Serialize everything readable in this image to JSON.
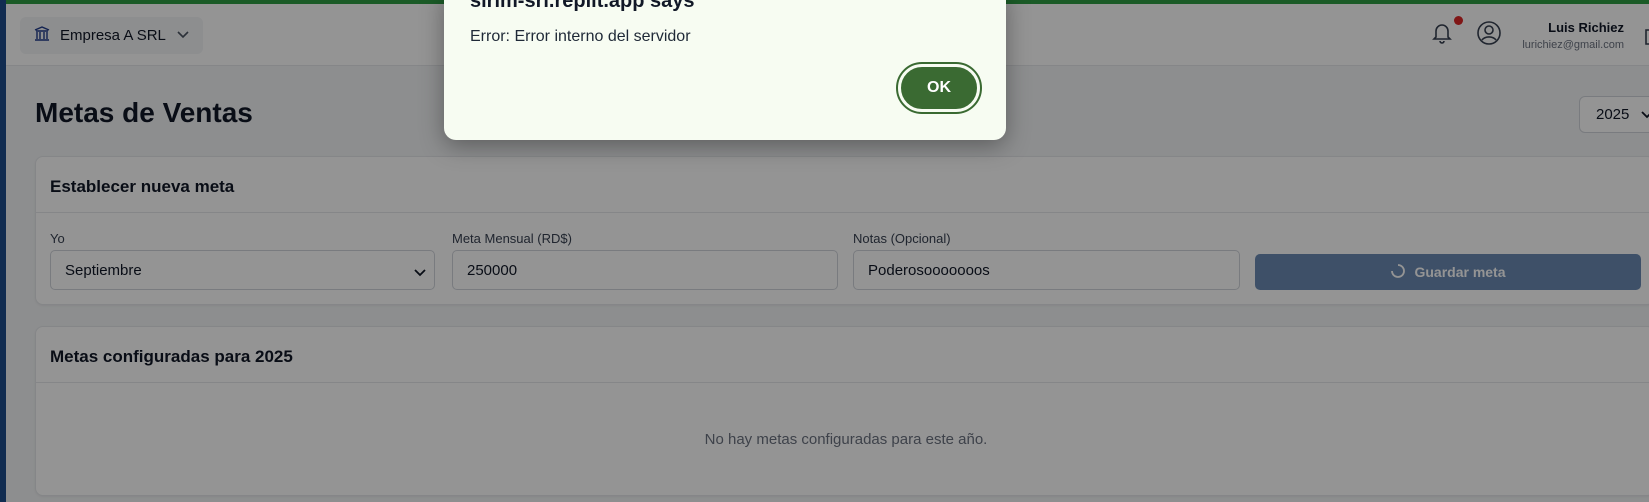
{
  "header": {
    "company_name": "Empresa A SRL",
    "user_name": "Luis Richiez",
    "user_email": "lurichiez@gmail.com"
  },
  "page": {
    "title": "Metas de Ventas",
    "year_selected": "2025"
  },
  "new_goal_card": {
    "title": "Establecer nueva meta",
    "month_label": "Yo",
    "month_value": "Septiembre",
    "amount_label": "Meta Mensual (RD$)",
    "amount_value": "250000",
    "notes_label": "Notas (Opcional)",
    "notes_value": "Poderosooooooos",
    "save_label": "Guardar meta"
  },
  "goals_card": {
    "title": "Metas configuradas para 2025",
    "empty_message": "No hay metas configuradas para este año."
  },
  "dialog": {
    "title": "sirim-srl.replit.app says",
    "message": "Error: Error interno del servidor",
    "ok_label": "OK"
  },
  "colors": {
    "accent_green": "#3a6a32",
    "top_progress": "#2f9e44",
    "disabled_button": "#6b8bb3",
    "notification_dot": "#dc2626"
  },
  "icons": {
    "company": "building-icon",
    "bell": "bell-icon",
    "user": "user-circle-icon",
    "logout": "logout-icon",
    "spinner": "spinner-icon"
  }
}
